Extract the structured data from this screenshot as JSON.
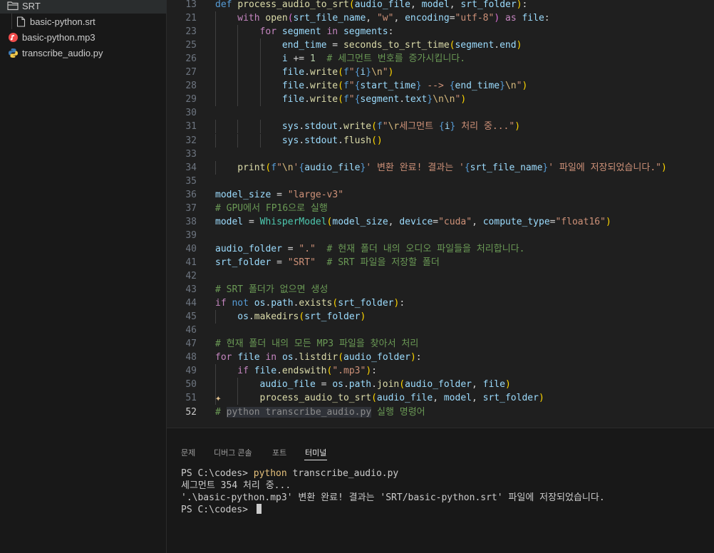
{
  "explorer": {
    "folder": "SRT",
    "files": [
      "basic-python.srt",
      "basic-python.mp3",
      "transcribe_audio.py"
    ]
  },
  "editor": {
    "active_line": "52",
    "lines": [
      {
        "n": "13",
        "t": [
          [
            "kw",
            "def "
          ],
          [
            "fn",
            "process_audio_to_srt"
          ],
          [
            "c1",
            "("
          ],
          [
            "var",
            "audio_file"
          ],
          [
            "plain",
            ", "
          ],
          [
            "var",
            "model"
          ],
          [
            "plain",
            ", "
          ],
          [
            "var",
            "srt_folder"
          ],
          [
            "c1",
            ")"
          ],
          [
            "plain",
            ":"
          ]
        ]
      },
      {
        "n": "21",
        "t": [
          [
            "ctl",
            "with "
          ],
          [
            "fn",
            "open"
          ],
          [
            "c2",
            "("
          ],
          [
            "var",
            "srt_file_name"
          ],
          [
            "plain",
            ", "
          ],
          [
            "str",
            "\"w\""
          ],
          [
            "plain",
            ", "
          ],
          [
            "var",
            "encoding"
          ],
          [
            "plain",
            "="
          ],
          [
            "str",
            "\"utf-8\""
          ],
          [
            "c2",
            ")"
          ],
          [
            "ctl",
            " as "
          ],
          [
            "var",
            "file"
          ],
          [
            "plain",
            ":"
          ]
        ]
      },
      {
        "n": "23",
        "t": [
          [
            "ctl",
            "for "
          ],
          [
            "var",
            "segment"
          ],
          [
            "ctl",
            " in "
          ],
          [
            "var",
            "segments"
          ],
          [
            "plain",
            ":"
          ]
        ]
      },
      {
        "n": "25",
        "t": [
          [
            "var",
            "end_time"
          ],
          [
            "plain",
            " = "
          ],
          [
            "fn",
            "seconds_to_srt_time"
          ],
          [
            "c1",
            "("
          ],
          [
            "var",
            "segment"
          ],
          [
            "plain",
            "."
          ],
          [
            "var",
            "end"
          ],
          [
            "c1",
            ")"
          ]
        ]
      },
      {
        "n": "26",
        "t": [
          [
            "var",
            "i"
          ],
          [
            "plain",
            " += "
          ],
          [
            "num",
            "1"
          ],
          [
            "cm",
            "  # 세그먼트 번호를 증가시킵니다."
          ]
        ]
      },
      {
        "n": "27",
        "t": [
          [
            "var",
            "file"
          ],
          [
            "plain",
            "."
          ],
          [
            "fn",
            "write"
          ],
          [
            "c1",
            "("
          ],
          [
            "kw",
            "f"
          ],
          [
            "str",
            "\""
          ],
          [
            "brace",
            "{"
          ],
          [
            "var",
            "i"
          ],
          [
            "brace",
            "}"
          ],
          [
            "esc",
            "\\n"
          ],
          [
            "str",
            "\""
          ],
          [
            "c1",
            ")"
          ]
        ]
      },
      {
        "n": "28",
        "t": [
          [
            "var",
            "file"
          ],
          [
            "plain",
            "."
          ],
          [
            "fn",
            "write"
          ],
          [
            "c1",
            "("
          ],
          [
            "kw",
            "f"
          ],
          [
            "str",
            "\""
          ],
          [
            "brace",
            "{"
          ],
          [
            "var",
            "start_time"
          ],
          [
            "brace",
            "}"
          ],
          [
            "str",
            " --> "
          ],
          [
            "brace",
            "{"
          ],
          [
            "var",
            "end_time"
          ],
          [
            "brace",
            "}"
          ],
          [
            "esc",
            "\\n"
          ],
          [
            "str",
            "\""
          ],
          [
            "c1",
            ")"
          ]
        ]
      },
      {
        "n": "29",
        "t": [
          [
            "var",
            "file"
          ],
          [
            "plain",
            "."
          ],
          [
            "fn",
            "write"
          ],
          [
            "c1",
            "("
          ],
          [
            "kw",
            "f"
          ],
          [
            "str",
            "\""
          ],
          [
            "brace",
            "{"
          ],
          [
            "var",
            "segment"
          ],
          [
            "plain",
            "."
          ],
          [
            "var",
            "text"
          ],
          [
            "brace",
            "}"
          ],
          [
            "esc",
            "\\n\\n"
          ],
          [
            "str",
            "\""
          ],
          [
            "c1",
            ")"
          ]
        ]
      },
      {
        "n": "30",
        "t": []
      },
      {
        "n": "31",
        "t": [
          [
            "var",
            "sys"
          ],
          [
            "plain",
            "."
          ],
          [
            "var",
            "stdout"
          ],
          [
            "plain",
            "."
          ],
          [
            "fn",
            "write"
          ],
          [
            "c1",
            "("
          ],
          [
            "kw",
            "f"
          ],
          [
            "str",
            "\""
          ],
          [
            "esc",
            "\\r"
          ],
          [
            "str",
            "세그먼트 "
          ],
          [
            "brace",
            "{"
          ],
          [
            "var",
            "i"
          ],
          [
            "brace",
            "}"
          ],
          [
            "str",
            " 처리 중...\""
          ],
          [
            "c1",
            ")"
          ]
        ]
      },
      {
        "n": "32",
        "t": [
          [
            "var",
            "sys"
          ],
          [
            "plain",
            "."
          ],
          [
            "var",
            "stdout"
          ],
          [
            "plain",
            "."
          ],
          [
            "fn",
            "flush"
          ],
          [
            "c1",
            "()"
          ]
        ]
      },
      {
        "n": "33",
        "t": []
      },
      {
        "n": "34",
        "t": [
          [
            "fn",
            "print"
          ],
          [
            "c1",
            "("
          ],
          [
            "kw",
            "f"
          ],
          [
            "str",
            "\""
          ],
          [
            "esc",
            "\\n"
          ],
          [
            "str",
            "'"
          ],
          [
            "brace",
            "{"
          ],
          [
            "var",
            "audio_file"
          ],
          [
            "brace",
            "}"
          ],
          [
            "str",
            "' 변환 완료! 결과는 '"
          ],
          [
            "brace",
            "{"
          ],
          [
            "var",
            "srt_file_name"
          ],
          [
            "brace",
            "}"
          ],
          [
            "str",
            "' 파일에 저장되었습니다.\""
          ],
          [
            "c1",
            ")"
          ]
        ]
      },
      {
        "n": "35",
        "t": []
      },
      {
        "n": "36",
        "t": [
          [
            "var",
            "model_size"
          ],
          [
            "plain",
            " = "
          ],
          [
            "str",
            "\"large-v3\""
          ]
        ]
      },
      {
        "n": "37",
        "t": [
          [
            "cm",
            "# GPU에서 FP16으로 실행"
          ]
        ]
      },
      {
        "n": "38",
        "t": [
          [
            "var",
            "model"
          ],
          [
            "plain",
            " = "
          ],
          [
            "cls",
            "WhisperModel"
          ],
          [
            "c1",
            "("
          ],
          [
            "var",
            "model_size"
          ],
          [
            "plain",
            ", "
          ],
          [
            "var",
            "device"
          ],
          [
            "plain",
            "="
          ],
          [
            "str",
            "\"cuda\""
          ],
          [
            "plain",
            ", "
          ],
          [
            "var",
            "compute_type"
          ],
          [
            "plain",
            "="
          ],
          [
            "str",
            "\"float16\""
          ],
          [
            "c1",
            ")"
          ]
        ]
      },
      {
        "n": "39",
        "t": []
      },
      {
        "n": "40",
        "t": [
          [
            "var",
            "audio_folder"
          ],
          [
            "plain",
            " = "
          ],
          [
            "str",
            "\".\""
          ],
          [
            "cm",
            "  # 현재 폴더 내의 오디오 파일들을 처리합니다."
          ]
        ]
      },
      {
        "n": "41",
        "t": [
          [
            "var",
            "srt_folder"
          ],
          [
            "plain",
            " = "
          ],
          [
            "str",
            "\"SRT\""
          ],
          [
            "cm",
            "  # SRT 파일을 저장할 폴더"
          ]
        ]
      },
      {
        "n": "42",
        "t": []
      },
      {
        "n": "43",
        "t": [
          [
            "cm",
            "# SRT 폴더가 없으면 생성"
          ]
        ]
      },
      {
        "n": "44",
        "t": [
          [
            "ctl",
            "if "
          ],
          [
            "kw",
            "not "
          ],
          [
            "var",
            "os"
          ],
          [
            "plain",
            "."
          ],
          [
            "var",
            "path"
          ],
          [
            "plain",
            "."
          ],
          [
            "fn",
            "exists"
          ],
          [
            "c1",
            "("
          ],
          [
            "var",
            "srt_folder"
          ],
          [
            "c1",
            ")"
          ],
          [
            "plain",
            ":"
          ]
        ]
      },
      {
        "n": "45",
        "t": [
          [
            "var",
            "os"
          ],
          [
            "plain",
            "."
          ],
          [
            "fn",
            "makedirs"
          ],
          [
            "c1",
            "("
          ],
          [
            "var",
            "srt_folder"
          ],
          [
            "c1",
            ")"
          ]
        ]
      },
      {
        "n": "46",
        "t": []
      },
      {
        "n": "47",
        "t": [
          [
            "cm",
            "# 현재 폴더 내의 모든 MP3 파일을 찾아서 처리"
          ]
        ]
      },
      {
        "n": "48",
        "t": [
          [
            "ctl",
            "for "
          ],
          [
            "var",
            "file"
          ],
          [
            "ctl",
            " in "
          ],
          [
            "var",
            "os"
          ],
          [
            "plain",
            "."
          ],
          [
            "fn",
            "listdir"
          ],
          [
            "c1",
            "("
          ],
          [
            "var",
            "audio_folder"
          ],
          [
            "c1",
            ")"
          ],
          [
            "plain",
            ":"
          ]
        ]
      },
      {
        "n": "49",
        "t": [
          [
            "ctl",
            "if "
          ],
          [
            "var",
            "file"
          ],
          [
            "plain",
            "."
          ],
          [
            "fn",
            "endswith"
          ],
          [
            "c1",
            "("
          ],
          [
            "str",
            "\".mp3\""
          ],
          [
            "c1",
            ")"
          ],
          [
            "plain",
            ":"
          ]
        ]
      },
      {
        "n": "50",
        "t": [
          [
            "var",
            "audio_file"
          ],
          [
            "plain",
            " = "
          ],
          [
            "var",
            "os"
          ],
          [
            "plain",
            "."
          ],
          [
            "var",
            "path"
          ],
          [
            "plain",
            "."
          ],
          [
            "fn",
            "join"
          ],
          [
            "c1",
            "("
          ],
          [
            "var",
            "audio_folder"
          ],
          [
            "plain",
            ", "
          ],
          [
            "var",
            "file"
          ],
          [
            "c1",
            ")"
          ]
        ]
      },
      {
        "n": "51",
        "t": [
          [
            "fn",
            "process_audio_to_srt"
          ],
          [
            "c1",
            "("
          ],
          [
            "var",
            "audio_file"
          ],
          [
            "plain",
            ", "
          ],
          [
            "var",
            "model"
          ],
          [
            "plain",
            ", "
          ],
          [
            "var",
            "srt_folder"
          ],
          [
            "c1",
            ")"
          ]
        ]
      },
      {
        "n": "52",
        "t": [
          [
            "cm",
            "# "
          ],
          [
            "cm-ghost",
            "python transcribe_audio.py"
          ],
          [
            "cm",
            " 실행 명령어"
          ]
        ]
      }
    ]
  },
  "panel": {
    "tabs": [
      "문제",
      "디버그 콘솔",
      "포트",
      "터미널"
    ],
    "active_tab": "터미널",
    "terminal": {
      "prompt1": "PS C:\\codes> ",
      "cmd": "python",
      "cmd_arg": " transcribe_audio.py",
      "out1": "세그먼트 354 처리 중...",
      "out2": "'.\\basic-python.mp3' 변환 완료! 결과는 'SRT/basic-python.srt' 파일에 저장되었습니다.",
      "prompt2": "PS C:\\codes> "
    }
  },
  "icons": {
    "folder": "folder-open-icon",
    "file": "file-icon",
    "audio": "audio-file-icon",
    "python": "python-file-icon",
    "sparkle": "sparkle-icon"
  }
}
